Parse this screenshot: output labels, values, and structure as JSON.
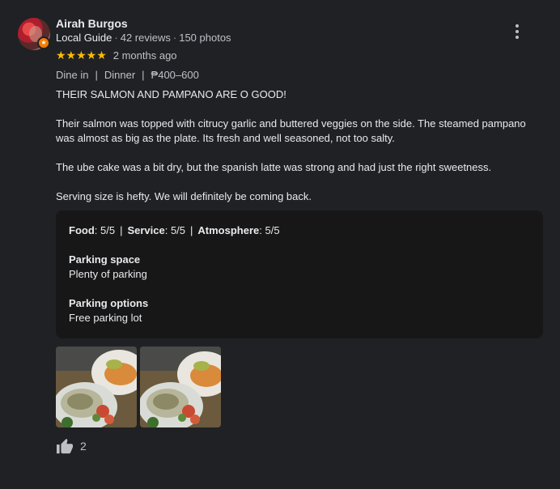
{
  "reviewer": {
    "name": "Airah Burgos",
    "guide_label": "Local Guide",
    "reviews": "42 reviews",
    "photos": "150 photos"
  },
  "rating": {
    "stars": "★★★★★",
    "time_ago": "2 months ago"
  },
  "tags": [
    "Dine in",
    "Dinner",
    "₱400–600"
  ],
  "review_text": [
    "THEIR SALMON AND PAMPANO ARE O GOOD!",
    "Their salmon was topped with citrucy garlic and buttered veggies on the side. The steamed pampano was almost as big as the plate. Its fresh and well seasoned, not too salty.",
    "The ube cake was a bit dry, but the spanish latte was strong and had just the right sweetness.",
    "Serving size is hefty. We will definitely be coming back."
  ],
  "details": {
    "food_label": "Food",
    "food_value": ": 5/5",
    "service_label": "Service",
    "service_value": ": 5/5",
    "atmosphere_label": "Atmosphere",
    "atmosphere_value": ": 5/5",
    "separator": "|",
    "parking_space_label": "Parking space",
    "parking_space_value": "Plenty of parking",
    "parking_options_label": "Parking options",
    "parking_options_value": "Free parking lot"
  },
  "likes": {
    "count": "2"
  },
  "colors": {
    "star": "#fbbc04",
    "badge": "#f57c00",
    "background": "#202124",
    "panel": "#171717"
  }
}
